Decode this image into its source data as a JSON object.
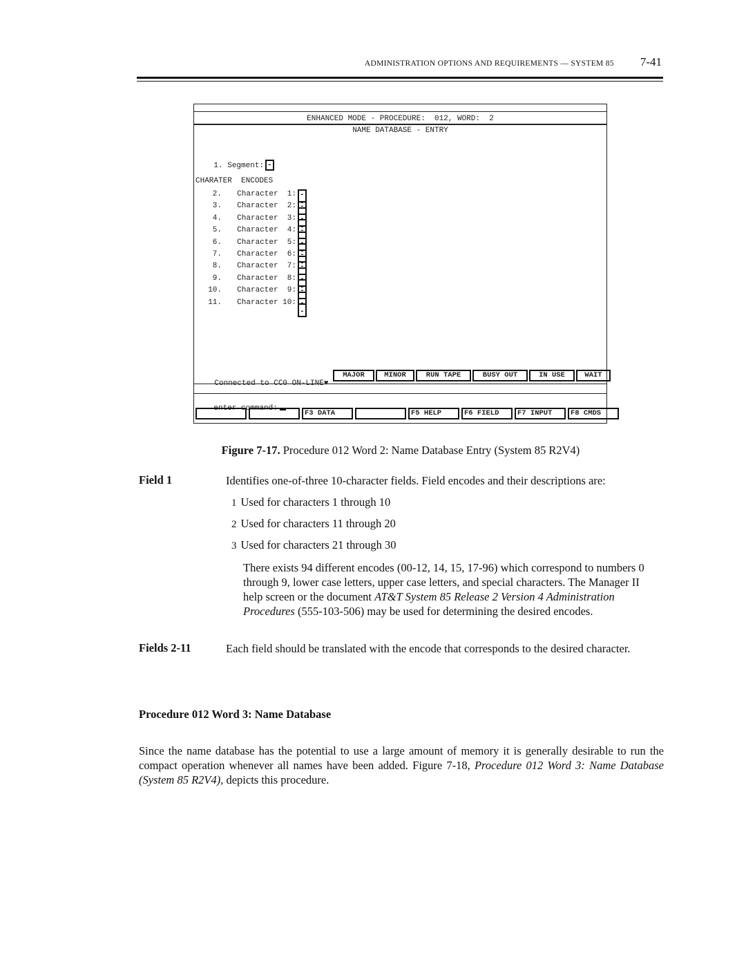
{
  "running_head": {
    "title": "ADMINISTRATION OPTIONS AND REQUIREMENTS — SYSTEM 85",
    "page_number": "7-41"
  },
  "terminal": {
    "header_line": "ENHANCED MODE - PROCEDURE:  012, WORD:  2",
    "subtitle": "NAME DATABASE - ENTRY",
    "segment": {
      "number": "1.",
      "label": "Segment:",
      "value": "-"
    },
    "encodes_heading": "CHARATER  ENCODES",
    "characters": [
      {
        "number": "2.",
        "label": "Character  1:",
        "value": "--"
      },
      {
        "number": "3.",
        "label": "Character  2:",
        "value": "--"
      },
      {
        "number": "4.",
        "label": "Character  3:",
        "value": "--"
      },
      {
        "number": "5.",
        "label": "Character  4:",
        "value": "--"
      },
      {
        "number": "6.",
        "label": "Character  5:",
        "value": "--"
      },
      {
        "number": "7.",
        "label": "Character  6:",
        "value": "--"
      },
      {
        "number": "8.",
        "label": "Character  7:",
        "value": "--"
      },
      {
        "number": "9.",
        "label": "Character  8:",
        "value": "--"
      },
      {
        "number": "10.",
        "label": "Character  9:",
        "value": "--"
      },
      {
        "number": "11.",
        "label": "Character 10:",
        "value": "--"
      }
    ],
    "status": {
      "connection": "Connected to CC0 ON-LINE",
      "indicators": [
        "MAJOR",
        "MINOR",
        "RUN TAPE",
        "BUSY OUT",
        "IN USE",
        "WAIT"
      ]
    },
    "command_prompt": "enter command:",
    "function_keys": [
      "",
      "",
      "F3 DATA",
      "",
      "F5 HELP",
      "F6 FIELD",
      "F7 INPUT",
      "F8 CMDS"
    ]
  },
  "figure_caption": {
    "number": "Figure 7-17.",
    "text": "Procedure 012 Word 2: Name Database Entry (System 85 R2V4)"
  },
  "field1": {
    "label": "Field 1",
    "intro": "Identifies one-of-three 10-character fields. Field encodes and their descriptions are:",
    "encodes": [
      {
        "code": "1",
        "desc": "Used for characters 1 through 10"
      },
      {
        "code": "2",
        "desc": "Used for characters 11 through 20"
      },
      {
        "code": "3",
        "desc": "Used for characters 21 through 30"
      }
    ],
    "note_part1": "There exists 94 different encodes (00-12, 14, 15, 17-96) which correspond to numbers 0 through 9, lower case letters, upper case letters, and special characters. The Manager II help screen or the document ",
    "note_italic": "AT&T System 85 Release 2 Version 4 Administration Procedures",
    "note_part2": " (555-103-506) may be used for determining the desired encodes."
  },
  "fields2_11": {
    "label": "Fields 2-11",
    "text": "Each field should be translated with the encode that corresponds to the desired character."
  },
  "section": {
    "heading": "Procedure 012 Word 3: Name Database",
    "para_part1": "Since the name database has the potential to use a large amount of memory it is generally desirable to run the compact operation whenever all names have been added. Figure 7-18, ",
    "para_italic": "Procedure 012 Word 3: Name Database (System 85 R2V4),",
    "para_part2": " depicts this procedure."
  }
}
